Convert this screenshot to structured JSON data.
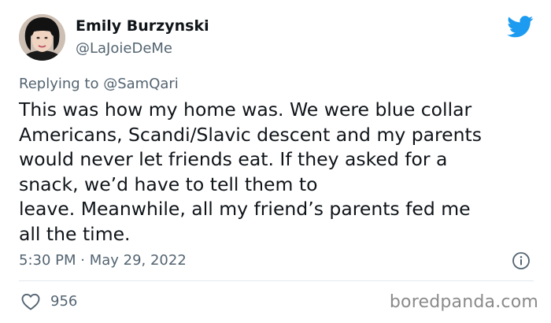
{
  "tweet": {
    "author_name": "Emily Burzynski",
    "author_handle": "@LaJoieDeMe",
    "replying_prefix": "Replying to ",
    "replying_to": "@SamQari",
    "body_lines": [
      "This was how my home was. We were blue collar",
      "Americans, Scandi/Slavic descent and my parents",
      "would never let friends eat. If they asked for a",
      "snack, we’d have to tell them to",
      "leave. Meanwhile, all my friend’s parents fed me",
      "all the time."
    ],
    "timestamp": "5:30 PM · May 29, 2022",
    "like_count": "956",
    "icons": {
      "brand": "twitter-bird-icon",
      "info": "info-icon",
      "like": "heart-icon"
    }
  },
  "watermark": "boredpanda.com",
  "colors": {
    "brand_blue": "#1d9bf0",
    "text_primary": "#0f1419",
    "text_secondary": "#536471",
    "divider": "#e1e8ed"
  }
}
